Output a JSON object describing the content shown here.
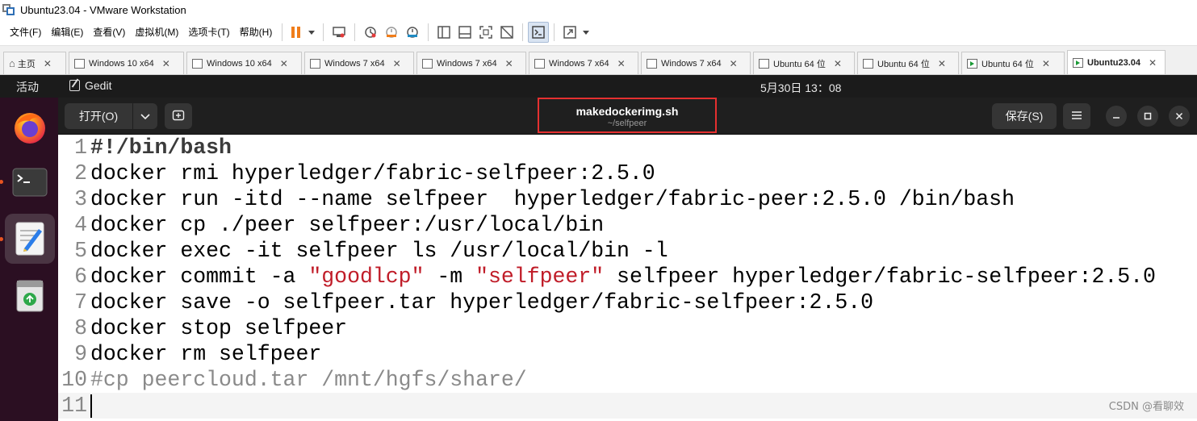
{
  "vmware": {
    "title": "Ubuntu23.04 - VMware Workstation",
    "menus": [
      "文件(F)",
      "编辑(E)",
      "查看(V)",
      "虚拟机(M)",
      "选项卡(T)",
      "帮助(H)"
    ],
    "tabs": [
      {
        "label": "主页",
        "icon": "home-icon"
      },
      {
        "label": "Windows 10 x64",
        "icon": "vm-icon"
      },
      {
        "label": "Windows 10 x64",
        "icon": "vm-icon"
      },
      {
        "label": "Windows 7 x64",
        "icon": "vm-icon"
      },
      {
        "label": "Windows 7 x64",
        "icon": "vm-icon"
      },
      {
        "label": "Windows 7 x64",
        "icon": "vm-icon"
      },
      {
        "label": "Windows 7 x64",
        "icon": "vm-icon"
      },
      {
        "label": "Ubuntu 64 位",
        "icon": "vm-icon"
      },
      {
        "label": "Ubuntu 64 位",
        "icon": "vm-icon"
      },
      {
        "label": "Ubuntu 64 位",
        "icon": "vm-running-icon"
      },
      {
        "label": "Ubuntu23.04",
        "icon": "vm-running-icon",
        "active": true
      }
    ]
  },
  "ubuntu": {
    "topbar": {
      "activities": "活动",
      "app_name": "Gedit",
      "clock": "5月30日  13：08"
    },
    "dock": [
      "firefox-icon",
      "terminal-icon",
      "text-editor-icon",
      "trash-icon"
    ]
  },
  "gedit": {
    "open_label": "打开(O)",
    "save_label": "保存(S)",
    "file_name": "makedockerimg.sh",
    "file_path": "~/selfpeer",
    "lines": [
      {
        "n": "1",
        "text": "#!/bin/bash"
      },
      {
        "n": "2",
        "text": "docker rmi hyperledger/fabric-selfpeer:2.5.0"
      },
      {
        "n": "3",
        "text": "docker run -itd --name selfpeer  hyperledger/fabric-peer:2.5.0 /bin/bash"
      },
      {
        "n": "4",
        "text": "docker cp ./peer selfpeer:/usr/local/bin"
      },
      {
        "n": "5",
        "text": "docker exec -it selfpeer ls /usr/local/bin -l"
      },
      {
        "n": "6",
        "pre": "docker commit -a ",
        "s1": "\"goodlcp\"",
        "mid": " -m ",
        "s2": "\"selfpeer\"",
        "post": " selfpeer hyperledger/fabric-selfpeer:2.5.0"
      },
      {
        "n": "7",
        "text": "docker save -o selfpeer.tar hyperledger/fabric-selfpeer:2.5.0"
      },
      {
        "n": "8",
        "text": "docker stop selfpeer"
      },
      {
        "n": "9",
        "text": "docker rm selfpeer"
      },
      {
        "n": "10",
        "text": "#cp peercloud.tar /mnt/hgfs/share/"
      },
      {
        "n": "11",
        "text": ""
      }
    ]
  },
  "watermark": "CSDN @看聊效",
  "colors": {
    "string": "#c01c28",
    "comment": "#8a8a8a",
    "title_highlight": "#e53030",
    "dock_bg": "#2b0f22",
    "headerbar_bg": "#1f1f1f"
  }
}
